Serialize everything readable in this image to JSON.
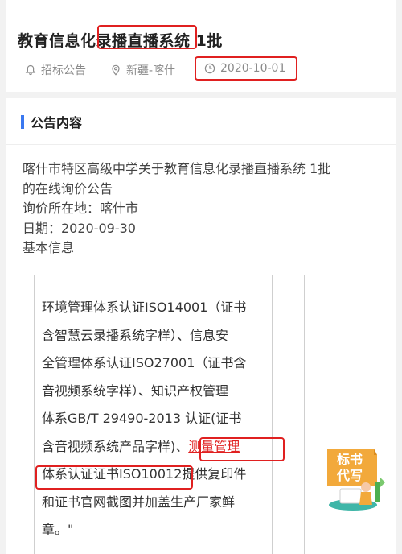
{
  "header": {
    "title": "教育信息化录播直播系统 1批",
    "category": "招标公告",
    "region": "新疆-喀什",
    "date": "2020-10-01"
  },
  "section": {
    "title": "公告内容"
  },
  "content": {
    "lines": [
      "喀什市特区高级中学关于教育信息化录播直播系统 1批",
      "的在线询价公告",
      "询价所在地：喀什市",
      "日期：2020-09-30",
      "基本信息"
    ]
  },
  "table_cell": {
    "lines": [
      "环境管理体系认证ISO14001（证书",
      "含智慧云录播系统字样）、信息安",
      "全管理体系认证ISO27001（证书含",
      "音视频系统字样）、知识产权管理",
      "体系GB/T 29490-2013 认证(证书",
      "含音视频系统产品字样)、",
      "体系认证证书ISO10012",
      "和证书官网截图并加盖生产厂家鲜",
      "章。\""
    ],
    "line6_highlight": "测量管理",
    "line7_tail": "提供复印件"
  },
  "badge": {
    "line1": "标书",
    "line2": "代写"
  },
  "colors": {
    "accent": "#3a78f0",
    "highlight": "#e02020",
    "badge": "#f2a93b"
  }
}
